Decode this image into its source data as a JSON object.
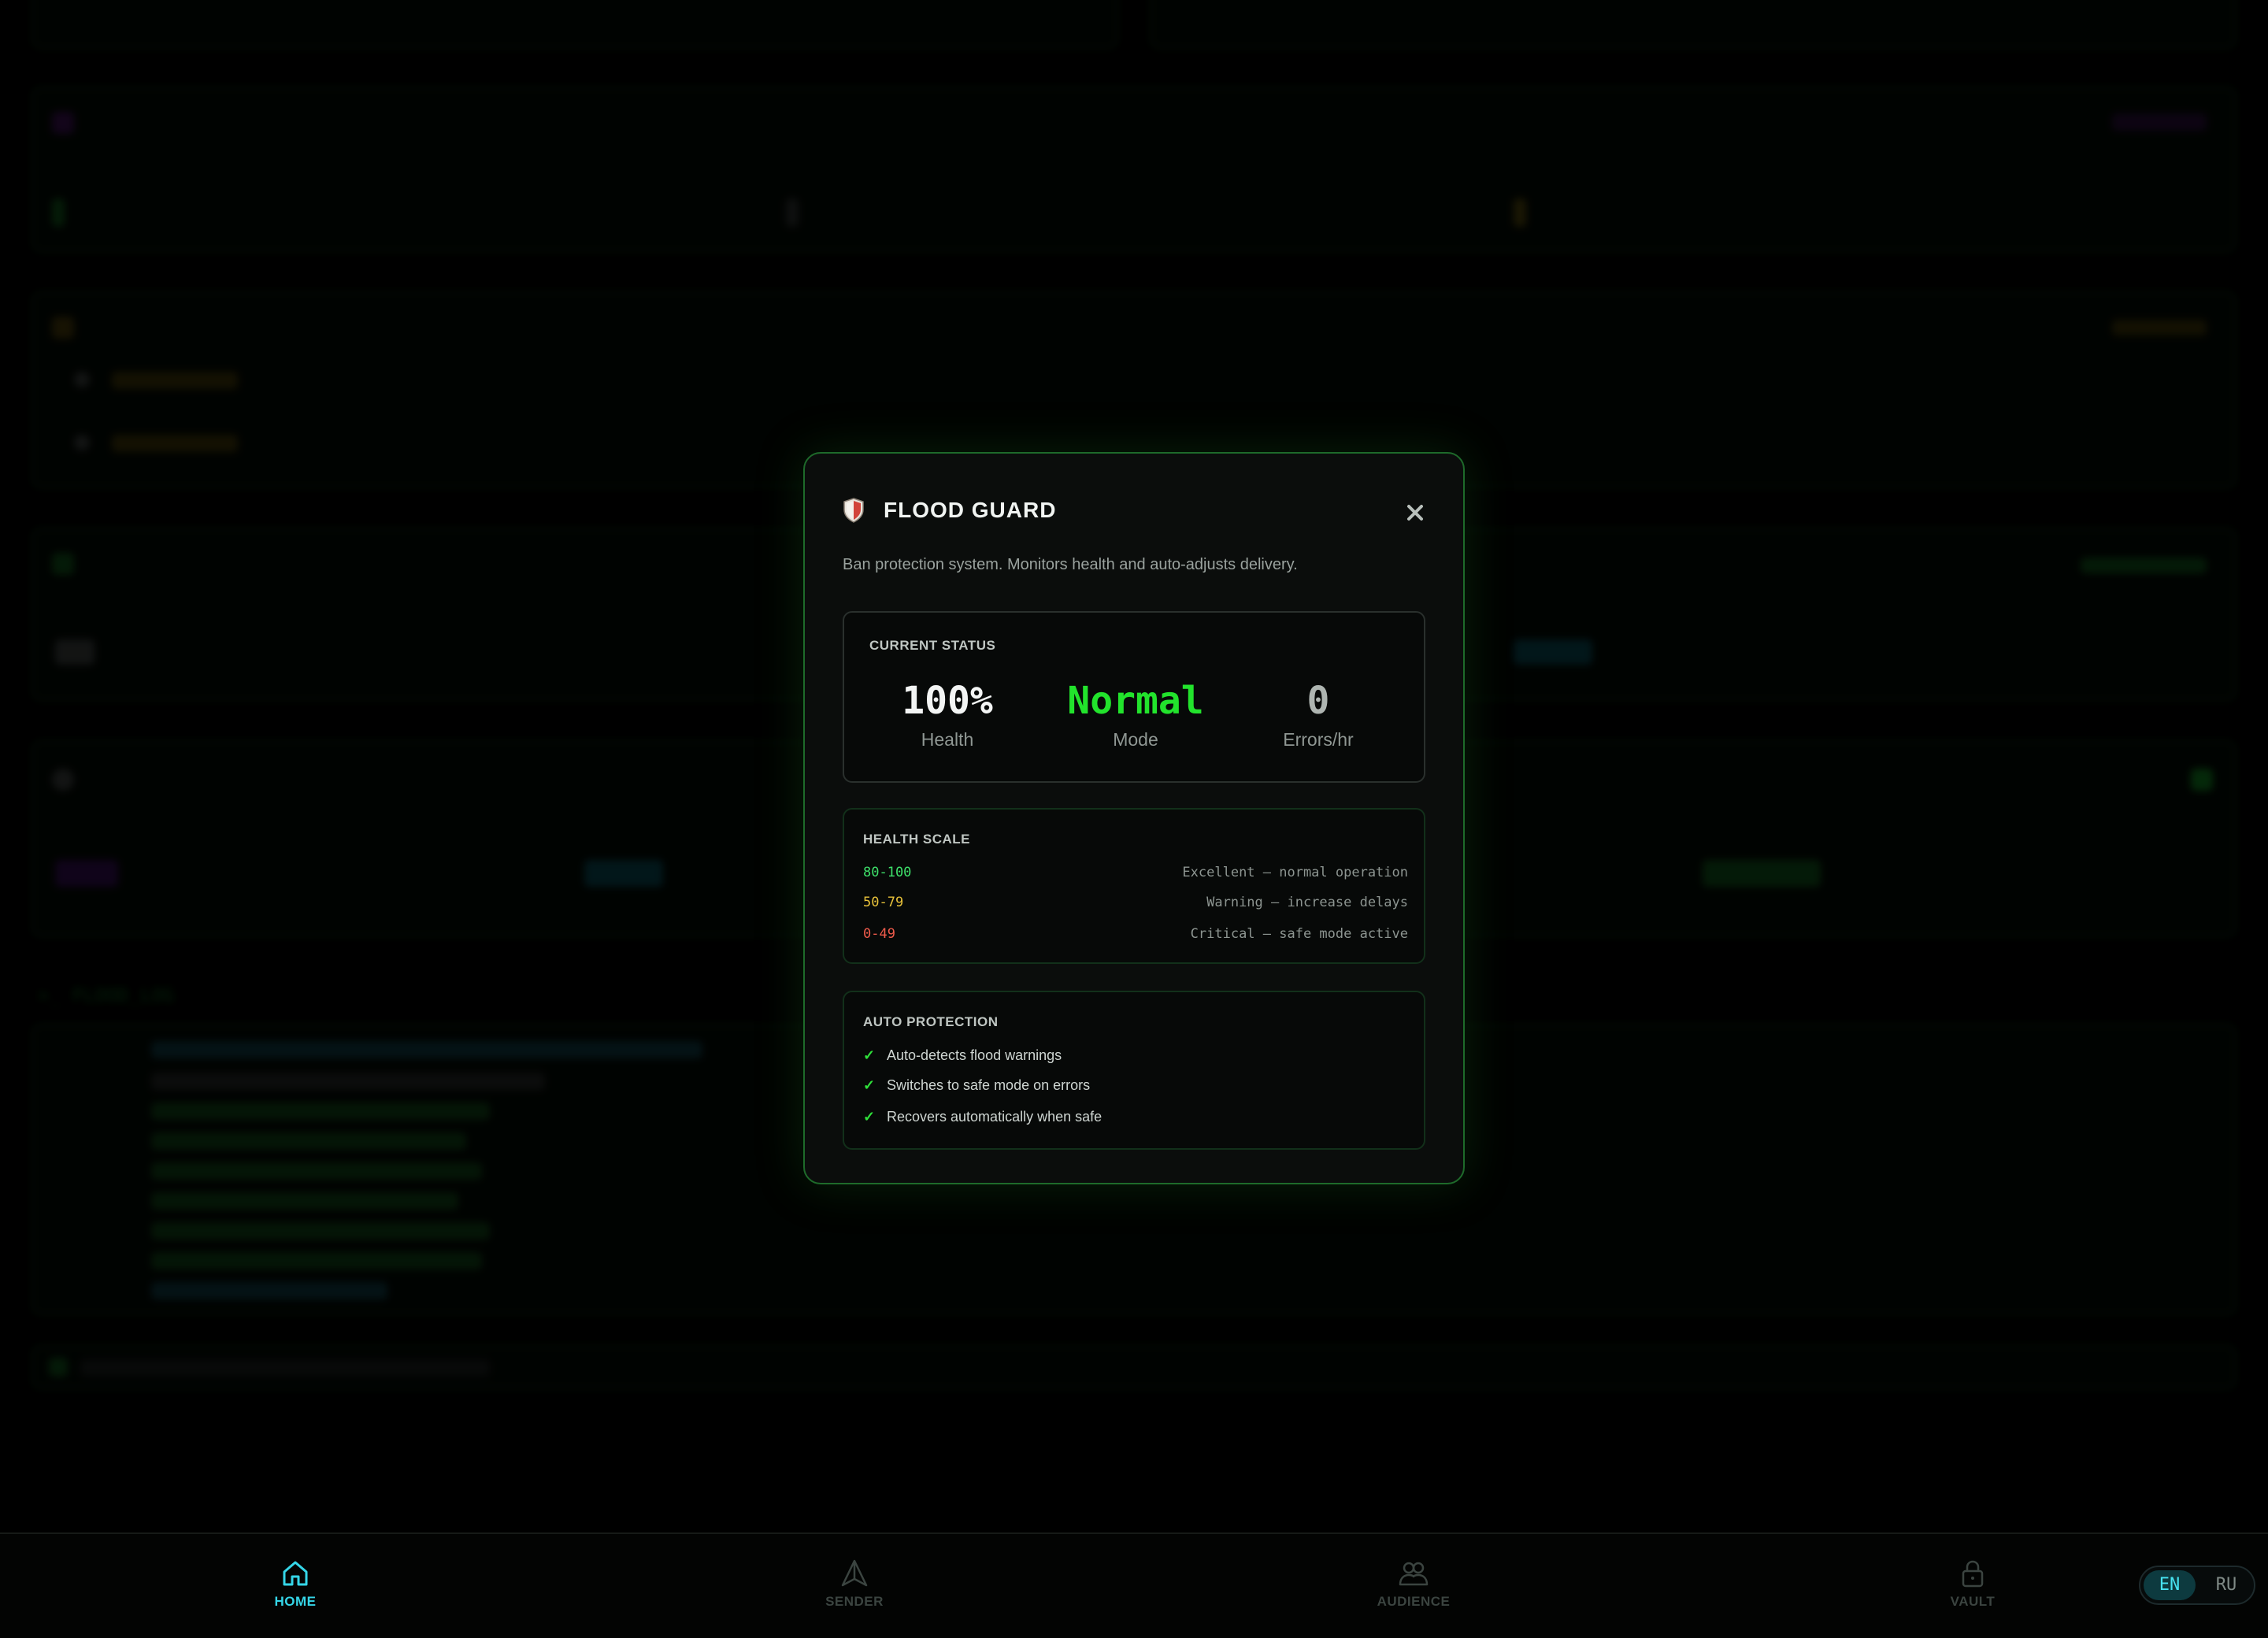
{
  "modal": {
    "title": "FLOOD GUARD",
    "description": "Ban protection system. Monitors health and auto-adjusts delivery.",
    "status": {
      "title": "CURRENT STATUS",
      "health": {
        "value": "100%",
        "label": "Health"
      },
      "mode": {
        "value": "Normal",
        "label": "Mode",
        "color": "#22e32c"
      },
      "errors": {
        "value": "0",
        "label": "Errors/hr"
      }
    },
    "health_scale": {
      "title": "HEALTH SCALE",
      "rows": [
        {
          "range": "80-100",
          "desc": "Excellent — normal operation",
          "color": "#3ee06a"
        },
        {
          "range": "50-79",
          "desc": "Warning — increase delays",
          "color": "#e8c23a"
        },
        {
          "range": "0-49",
          "desc": "Critical — safe mode active",
          "color": "#ef5b4b"
        }
      ]
    },
    "auto_protection": {
      "title": "AUTO PROTECTION",
      "items": [
        "Auto-detects flood warnings",
        "Switches to safe mode on errors",
        "Recovers automatically when safe"
      ]
    }
  },
  "nav": {
    "items": [
      {
        "label": "HOME",
        "icon": "home-icon",
        "active": true
      },
      {
        "label": "SENDER",
        "icon": "send-icon",
        "active": false
      },
      {
        "label": "AUDIENCE",
        "icon": "users-icon",
        "active": false
      },
      {
        "label": "VAULT",
        "icon": "lock-icon",
        "active": false
      }
    ],
    "lang": {
      "en": "EN",
      "ru": "RU",
      "active": "EN"
    }
  },
  "colors": {
    "accent": "#35d6e8",
    "border": "#1e6a2a",
    "success": "#22e32c"
  }
}
